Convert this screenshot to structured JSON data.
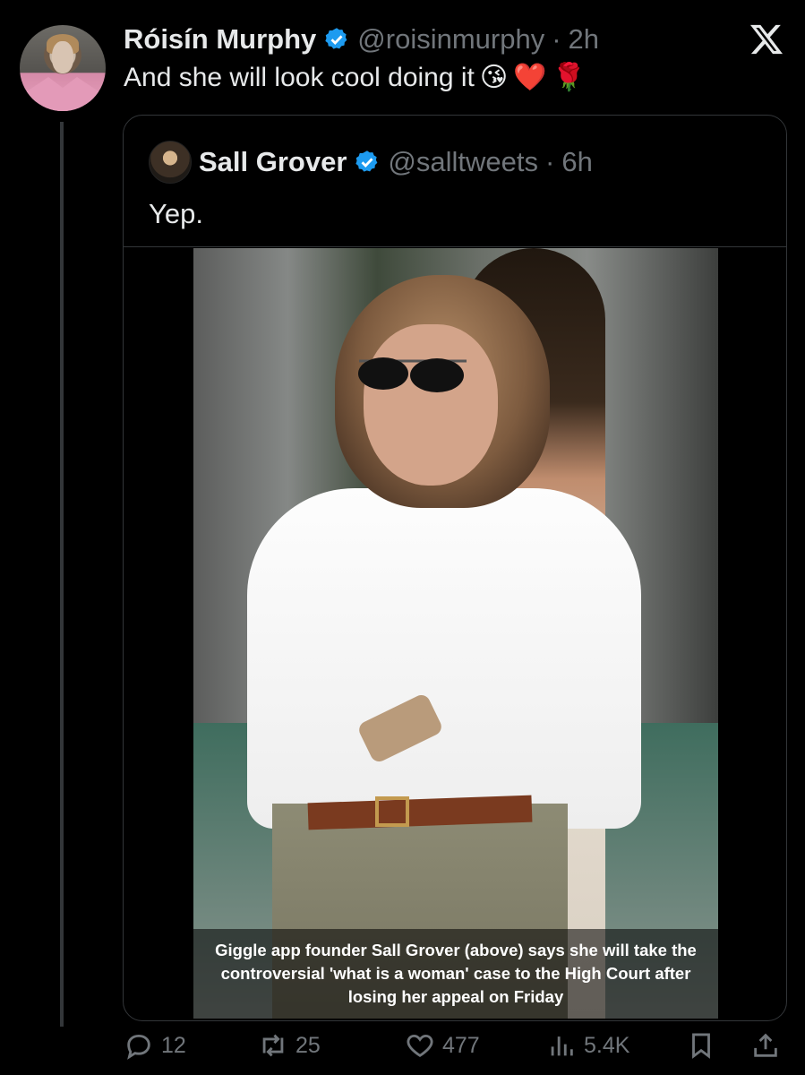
{
  "tweet": {
    "author_name": "Róisín Murphy",
    "author_handle": "@roisinmurphy",
    "separator": "·",
    "time": "2h",
    "text": "And she will look cool doing it",
    "emojis": [
      "😘",
      "❤️",
      "🌹"
    ]
  },
  "quoted": {
    "author_name": "Sall Grover",
    "author_handle": "@salltweets",
    "separator": "·",
    "time": "6h",
    "text": "Yep.",
    "image_caption": "Giggle app founder Sall Grover (above) says she will take the controversial 'what is a woman' case to the High Court after losing her appeal on Friday"
  },
  "actions": {
    "replies": "12",
    "reposts": "25",
    "likes": "477",
    "views": "5.4K"
  },
  "icons": {
    "close": "x-logo-icon",
    "verified": "verified-badge-icon",
    "reply": "reply-icon",
    "repost": "repost-icon",
    "like": "heart-icon",
    "views": "views-icon",
    "bookmark": "bookmark-icon",
    "share": "share-icon"
  },
  "colors": {
    "background": "#000000",
    "text": "#e7e9ea",
    "muted": "#71767b",
    "verified": "#1d9bf0",
    "border": "#333639"
  }
}
